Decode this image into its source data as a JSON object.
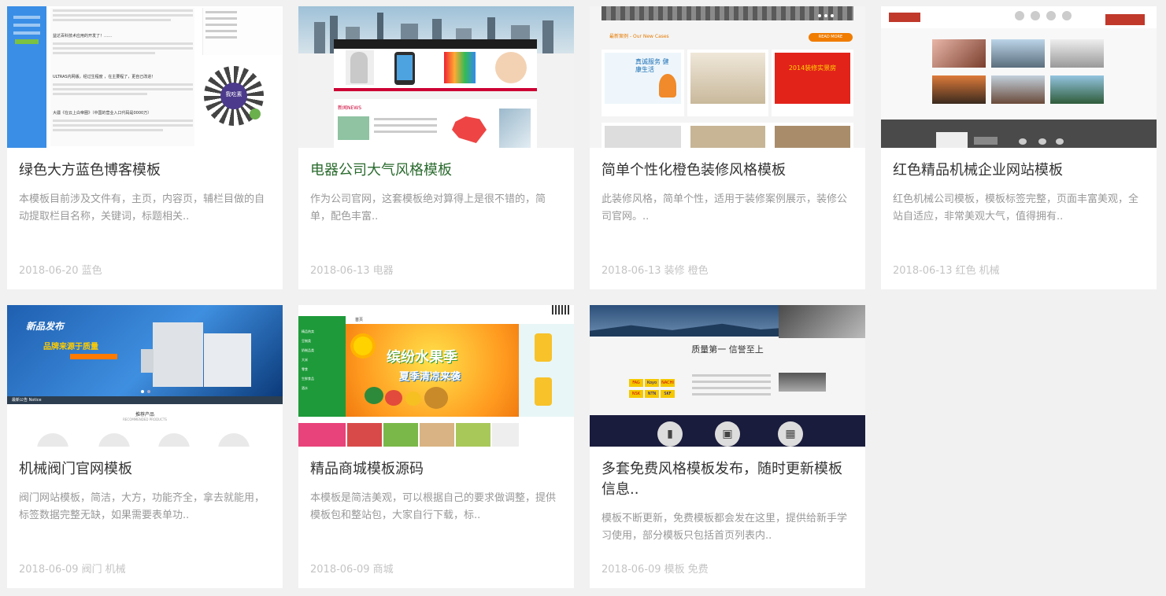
{
  "cards": [
    {
      "title": "绿色大方蓝色博客模板",
      "desc": "本模板目前涉及文件有，主页，内容页，辅栏目做的自动提取栏目名称，关键词，标题相关..",
      "date": "2018-06-20",
      "tags": [
        "蓝色"
      ],
      "thumb": {
        "post_titles": [
          "益达百科技术应用的开发了！……",
          "ULTRAS内网版，经过生程度 ，在主要程了，更自己改进！",
          "大疆《在云上白帝圈》（中国的营业入口代码是0000万）"
        ],
        "qr_text": "我吃素"
      }
    },
    {
      "title": "电器公司大气风格模板",
      "desc": "作为公司官网，这套模板绝对算得上是很不错的，简单，配色丰富..",
      "date": "2018-06-13",
      "tags": [
        "电器"
      ],
      "thumb": {
        "section": "新闻NEWS"
      }
    },
    {
      "title": "简单个性化橙色装修风格模板",
      "desc": "此装修风格，简单个性，适用于装修案例展示，装修公司官网。..",
      "date": "2018-06-13",
      "tags": [
        "装修",
        "橙色"
      ],
      "thumb": {
        "heading": "最新案例 - Our New Cases",
        "button": "READ MORE",
        "case_texts": [
          "真诚服务 健康生活",
          "2014装修实景房"
        ]
      }
    },
    {
      "title": "红色精品机械企业网站模板",
      "desc": "红色机械公司模板，模板标签完整，页面丰富美观，全站自适应，非常美观大气，值得拥有..",
      "date": "2018-06-13",
      "tags": [
        "红色",
        "机械"
      ],
      "thumb": {}
    },
    {
      "title": "机械阀门官网模板",
      "desc": "阀门网站模板，简洁，大方，功能齐全，拿去就能用，标签数据完整无缺，如果需要表单功..",
      "date": "2018-06-09",
      "tags": [
        "阀门",
        "机械"
      ],
      "thumb": {
        "banner_heading": "新品发布",
        "banner_slogan": "品牌来源于质量",
        "notice": "最新公告 Notice",
        "products_heading": "推荐产品",
        "products_sub": "RECOMMENDED PRODUCTS"
      }
    },
    {
      "title": "精品商城模板源码",
      "desc": "本模板是简洁美观，可以根据自己的要求做调整，提供模板包和整站包，大家自行下载，标..",
      "date": "2018-06-09",
      "tags": [
        "商城"
      ],
      "thumb": {
        "banner_line1": "缤纷水果季",
        "banner_line2": "夏季清凉来袭",
        "nav": [
          "首页"
        ],
        "side_items": [
          "精品热卖",
          "豆制类",
          "奶制品类",
          "大米",
          "零食",
          "生鲜食品",
          "酒水"
        ]
      }
    },
    {
      "title": "多套免费风格模板发布，随时更新模板信息..",
      "desc": "模板不断更新，免费模板都会发在这里，提供给新手学习使用，部分模板只包括首页列表内..",
      "date": "2018-06-09",
      "tags": [
        "模板",
        "免费"
      ],
      "thumb": {
        "slogan": "质量第一 信誉至上",
        "brands": [
          "FAG",
          "Koyo",
          "NACHI",
          "NSK",
          "NTN",
          "SKF"
        ]
      }
    }
  ]
}
